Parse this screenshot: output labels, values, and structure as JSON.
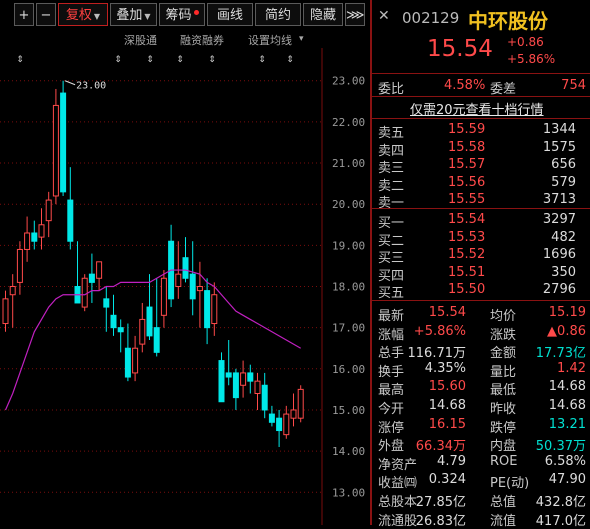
{
  "toolbar": {
    "zoom_in": "+",
    "zoom_out": "−",
    "restore_right": "复权",
    "overlay": "叠加",
    "chips": "筹码",
    "draw_line": "画线",
    "simple": "简约",
    "hide": "隐藏",
    "expand": "⋙"
  },
  "subbar": {
    "shenzhen_connect": "深股通",
    "margin_trading": "融资融券",
    "set_ma": "设置均线",
    "set_ma_arrow": "▾"
  },
  "chart_data": {
    "type": "candlestick",
    "ylim": [
      12.8,
      23.2
    ],
    "y_ticks": [
      "23.00",
      "22.00",
      "21.00",
      "20.00",
      "19.00",
      "18.00",
      "17.00",
      "16.00",
      "15.00",
      "14.00",
      "13.00"
    ],
    "high_annotation": "23.00",
    "markers": [
      "*",
      "*",
      "*"
    ],
    "candles": [
      {
        "o": 17.1,
        "h": 17.9,
        "l": 16.9,
        "c": 17.7,
        "up": true
      },
      {
        "o": 17.8,
        "h": 18.3,
        "l": 17.0,
        "c": 18.0,
        "up": true
      },
      {
        "o": 18.1,
        "h": 19.1,
        "l": 17.8,
        "c": 18.9,
        "up": true
      },
      {
        "o": 18.9,
        "h": 19.7,
        "l": 18.6,
        "c": 19.3,
        "up": true
      },
      {
        "o": 19.3,
        "h": 19.6,
        "l": 18.9,
        "c": 19.1,
        "up": false
      },
      {
        "o": 19.2,
        "h": 19.9,
        "l": 18.9,
        "c": 19.5,
        "up": true
      },
      {
        "o": 19.6,
        "h": 20.3,
        "l": 19.2,
        "c": 20.1,
        "up": true
      },
      {
        "o": 20.2,
        "h": 22.8,
        "l": 20.0,
        "c": 22.4,
        "up": true
      },
      {
        "o": 22.7,
        "h": 23.0,
        "l": 20.2,
        "c": 20.3,
        "up": false
      },
      {
        "o": 20.1,
        "h": 20.9,
        "l": 18.9,
        "c": 19.1,
        "up": false
      },
      {
        "o": 18.0,
        "h": 19.1,
        "l": 17.8,
        "c": 17.6,
        "up": false
      },
      {
        "o": 17.5,
        "h": 18.3,
        "l": 17.4,
        "c": 18.2,
        "up": true
      },
      {
        "o": 18.1,
        "h": 18.8,
        "l": 17.6,
        "c": 18.3,
        "up": false
      },
      {
        "o": 18.2,
        "h": 18.5,
        "l": 17.9,
        "c": 18.6,
        "up": true
      },
      {
        "o": 17.7,
        "h": 18.0,
        "l": 16.9,
        "c": 17.5,
        "up": false
      },
      {
        "o": 17.3,
        "h": 17.8,
        "l": 16.8,
        "c": 17.0,
        "up": false
      },
      {
        "o": 16.9,
        "h": 17.2,
        "l": 16.4,
        "c": 17.0,
        "up": false
      },
      {
        "o": 16.5,
        "h": 17.1,
        "l": 15.7,
        "c": 15.8,
        "up": false
      },
      {
        "o": 15.9,
        "h": 16.8,
        "l": 15.7,
        "c": 16.5,
        "up": true
      },
      {
        "o": 16.6,
        "h": 17.6,
        "l": 16.4,
        "c": 17.2,
        "up": true
      },
      {
        "o": 17.5,
        "h": 18.3,
        "l": 16.7,
        "c": 16.8,
        "up": false
      },
      {
        "o": 17.0,
        "h": 18.2,
        "l": 16.3,
        "c": 16.4,
        "up": false
      },
      {
        "o": 17.3,
        "h": 18.4,
        "l": 17.0,
        "c": 18.2,
        "up": true
      },
      {
        "o": 19.1,
        "h": 19.5,
        "l": 17.5,
        "c": 17.7,
        "up": false
      },
      {
        "o": 18.0,
        "h": 19.1,
        "l": 17.7,
        "c": 18.3,
        "up": true
      },
      {
        "o": 18.7,
        "h": 19.2,
        "l": 18.1,
        "c": 18.2,
        "up": false
      },
      {
        "o": 18.3,
        "h": 19.1,
        "l": 17.3,
        "c": 17.7,
        "up": false
      },
      {
        "o": 17.9,
        "h": 18.6,
        "l": 17.0,
        "c": 18.0,
        "up": true
      },
      {
        "o": 17.9,
        "h": 18.2,
        "l": 16.6,
        "c": 17.0,
        "up": false
      },
      {
        "o": 17.1,
        "h": 18.1,
        "l": 16.8,
        "c": 17.8,
        "up": true
      },
      {
        "o": 16.2,
        "h": 16.4,
        "l": 15.2,
        "c": 15.2,
        "up": false
      },
      {
        "o": 15.9,
        "h": 16.7,
        "l": 15.6,
        "c": 15.8,
        "up": false
      },
      {
        "o": 15.9,
        "h": 16.0,
        "l": 15.0,
        "c": 15.3,
        "up": false
      },
      {
        "o": 15.6,
        "h": 16.2,
        "l": 15.3,
        "c": 15.9,
        "up": true
      },
      {
        "o": 15.9,
        "h": 16.1,
        "l": 15.4,
        "c": 15.7,
        "up": false
      },
      {
        "o": 15.4,
        "h": 15.9,
        "l": 15.0,
        "c": 15.7,
        "up": true
      },
      {
        "o": 15.6,
        "h": 15.9,
        "l": 14.8,
        "c": 15.0,
        "up": false
      },
      {
        "o": 14.9,
        "h": 15.1,
        "l": 14.6,
        "c": 14.7,
        "up": false
      },
      {
        "o": 14.8,
        "h": 15.0,
        "l": 14.1,
        "c": 14.5,
        "up": false
      },
      {
        "o": 14.4,
        "h": 15.1,
        "l": 14.3,
        "c": 14.9,
        "up": true
      },
      {
        "o": 14.8,
        "h": 15.4,
        "l": 14.6,
        "c": 15.0,
        "up": true
      },
      {
        "o": 14.8,
        "h": 15.6,
        "l": 14.7,
        "c": 15.5,
        "up": true
      }
    ],
    "ma": [
      15.0,
      15.4,
      15.9,
      16.4,
      16.9,
      17.2,
      17.5,
      17.7,
      17.8,
      17.8,
      17.8,
      17.8,
      17.9,
      17.9,
      18.0,
      18.0,
      18.1,
      18.1,
      18.1,
      18.1,
      18.1,
      18.2,
      18.3,
      18.4,
      18.4,
      18.4,
      18.35,
      18.3,
      18.1,
      18.0,
      17.8,
      17.6,
      17.4,
      17.3,
      17.2,
      17.1,
      17.0,
      16.9,
      16.8,
      16.7,
      16.6,
      16.5
    ]
  },
  "stock": {
    "code": "002129",
    "name": "中环股份",
    "price": "15.54",
    "change": "+0.86",
    "change_pct": "+5.86%"
  },
  "order": {
    "weibi_label": "委比",
    "weibi": "4.58%",
    "weicha_label": "委差",
    "weicha": "754",
    "promo": "仅需20元查看十档行情"
  },
  "asks": [
    {
      "label": "卖五",
      "price": "15.59",
      "vol": "1344"
    },
    {
      "label": "卖四",
      "price": "15.58",
      "vol": "1575"
    },
    {
      "label": "卖三",
      "price": "15.57",
      "vol": "656"
    },
    {
      "label": "卖二",
      "price": "15.56",
      "vol": "579"
    },
    {
      "label": "卖一",
      "price": "15.55",
      "vol": "3713"
    }
  ],
  "bids": [
    {
      "label": "买一",
      "price": "15.54",
      "vol": "3297"
    },
    {
      "label": "买二",
      "price": "15.53",
      "vol": "482"
    },
    {
      "label": "买三",
      "price": "15.52",
      "vol": "1696"
    },
    {
      "label": "买四",
      "price": "15.51",
      "vol": "350"
    },
    {
      "label": "买五",
      "price": "15.50",
      "vol": "2796"
    }
  ],
  "stats": [
    {
      "l1": "最新",
      "v1": "15.54",
      "c1": "red",
      "l2": "均价",
      "v2": "15.19",
      "c2": "red"
    },
    {
      "l1": "涨幅",
      "v1": "+5.86%",
      "c1": "red",
      "l2": "涨跌",
      "v2": "▲0.86",
      "c2": "red"
    },
    {
      "l1": "总手",
      "v1": "116.71万",
      "c1": "white",
      "l2": "金额",
      "v2": "17.73亿",
      "c2": "green"
    },
    {
      "l1": "换手",
      "v1": "4.35%",
      "c1": "white",
      "l2": "量比",
      "v2": "1.42",
      "c2": "red"
    },
    {
      "l1": "最高",
      "v1": "15.60",
      "c1": "red",
      "l2": "最低",
      "v2": "14.68",
      "c2": "white"
    },
    {
      "l1": "今开",
      "v1": "14.68",
      "c1": "white",
      "l2": "昨收",
      "v2": "14.68",
      "c2": "white"
    },
    {
      "l1": "涨停",
      "v1": "16.15",
      "c1": "red",
      "l2": "跌停",
      "v2": "13.21",
      "c2": "green"
    },
    {
      "l1": "外盘",
      "v1": "66.34万",
      "c1": "red",
      "l2": "内盘",
      "v2": "50.37万",
      "c2": "green"
    },
    {
      "l1": "净资产",
      "v1": "4.79",
      "c1": "white",
      "l2": "ROE",
      "v2": "6.58%",
      "c2": "white"
    },
    {
      "l1": "收益㈣",
      "v1": "0.324",
      "c1": "white",
      "l2": "PE(动)",
      "v2": "47.90",
      "c2": "white"
    },
    {
      "l1": "总股本",
      "v1": "27.85亿",
      "c1": "white",
      "l2": "总值",
      "v2": "432.8亿",
      "c2": "white"
    },
    {
      "l1": "流通股",
      "v1": "26.83亿",
      "c1": "white",
      "l2": "流值",
      "v2": "417.0亿",
      "c2": "white"
    }
  ],
  "colors": {
    "up": "#ff4a4a",
    "down": "#00e8e8",
    "ma": "#c020c0",
    "grid": "#7a0d0d",
    "bg": "#000000",
    "name": "#f0c020"
  }
}
